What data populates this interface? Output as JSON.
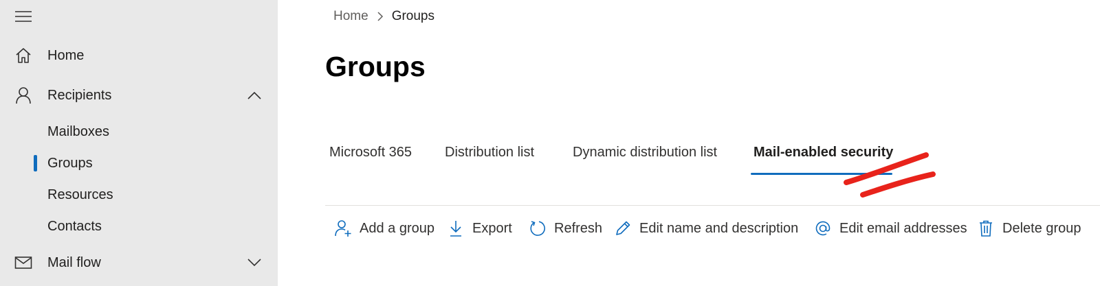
{
  "sidebar": {
    "items": [
      {
        "label": "Home",
        "icon": "home-icon"
      },
      {
        "label": "Recipients",
        "icon": "person-icon",
        "expanded": true
      },
      {
        "label": "Mail flow",
        "icon": "mail-icon",
        "expanded": false
      }
    ],
    "recipients_children": [
      {
        "label": "Mailboxes"
      },
      {
        "label": "Groups",
        "active": true
      },
      {
        "label": "Resources"
      },
      {
        "label": "Contacts"
      }
    ]
  },
  "breadcrumb": {
    "home": "Home",
    "current": "Groups"
  },
  "page": {
    "title": "Groups"
  },
  "tabs": [
    {
      "label": "Microsoft 365"
    },
    {
      "label": "Distribution list"
    },
    {
      "label": "Dynamic distribution list"
    },
    {
      "label": "Mail-enabled security",
      "active": true
    }
  ],
  "toolbar": {
    "add_group": "Add a group",
    "export": "Export",
    "refresh": "Refresh",
    "edit_name": "Edit name and description",
    "edit_email": "Edit email addresses",
    "delete_group": "Delete group"
  },
  "colors": {
    "accent": "#0f6cbd",
    "sidebar_bg": "#e9e9e9",
    "annotation": "#e8231b"
  }
}
